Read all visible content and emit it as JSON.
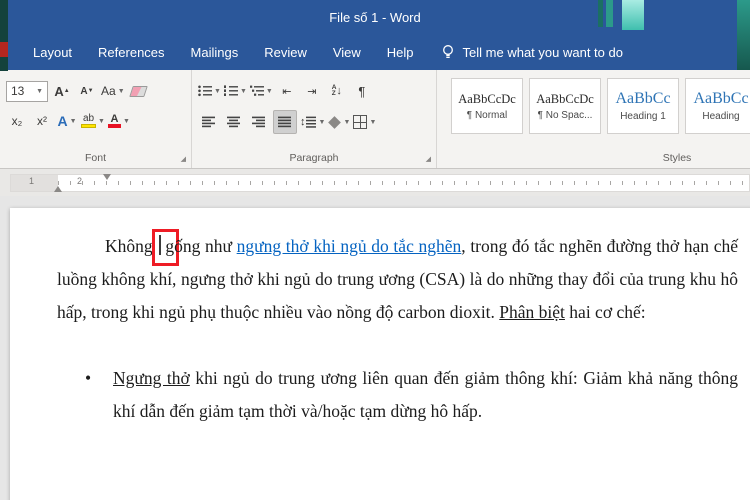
{
  "window": {
    "title": "File số 1  -  Word"
  },
  "menubar": {
    "tabs": [
      "Layout",
      "References",
      "Mailings",
      "Review",
      "View",
      "Help"
    ],
    "tellme": "Tell me what you want to do"
  },
  "ribbon": {
    "font": {
      "label": "Font",
      "size_value": "13"
    },
    "paragraph": {
      "label": "Paragraph"
    },
    "styles": {
      "label": "Styles",
      "gallery": [
        {
          "preview": "AaBbCcDc",
          "name": "¶ Normal"
        },
        {
          "preview": "AaBbCcDc",
          "name": "¶ No Spac..."
        },
        {
          "preview": "AaBbCc",
          "name": "Heading 1"
        },
        {
          "preview": "AaBbCc",
          "name": "Heading"
        }
      ]
    }
  },
  "ruler": {
    "numbers": [
      "1",
      "2"
    ]
  },
  "document": {
    "paragraph1": {
      "lead": "Không ",
      "boxed_char": "g",
      "after_box": "ống như ",
      "link": "ngưng thở khi ngủ do tắc nghẽn",
      "mid": ", trong đó tắc nghẽn đường thở hạn chế luồng không khí, ngưng thở khi ngủ do trung ương (CSA) là do những thay đổi của trung khu hô hấp, trong khi ngủ phụ thuộc nhiều vào nồng độ carbon dioxit. ",
      "emphasis": "Phân biệt",
      "tail": " hai cơ chế:"
    },
    "bullet_item": {
      "glyph": "•",
      "emphasis": "Ngưng thở",
      "text": " khi ngủ do trung ương liên quan đến giảm thông khí: Giảm khả năng thông khí dẫn đến giảm tạm thời và/hoặc tạm dừng hô hấp."
    }
  },
  "colors": {
    "titlebar": "#2b579a",
    "hyperlink": "#0563c1",
    "annotation_box": "#ee1c25",
    "heading_preview": "#2e74b5",
    "highlight_yellow": "#ffe400",
    "font_color_red": "#e81123"
  }
}
